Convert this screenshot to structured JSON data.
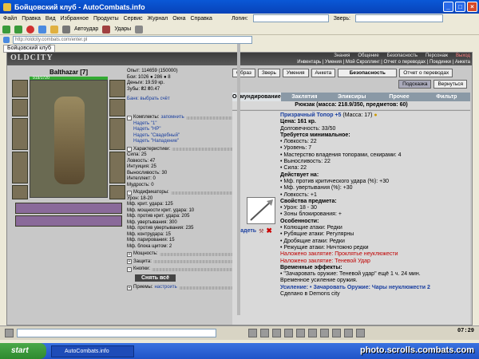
{
  "window": {
    "title": "Бойцовский клуб - AutoCombats.info"
  },
  "menu": [
    "Файл",
    "Правка",
    "Вид",
    "Избранное",
    "Продукты",
    "Сервис",
    "Журнал",
    "Окна",
    "Справка"
  ],
  "toolbar": {
    "login_label": "Логин:",
    "beast_label": "Зверь:",
    "autohit": "Автоудар",
    "hits": "Удары"
  },
  "address": {
    "url": "http://oldcity.combats.com/enter.pl"
  },
  "tabs": [
    "Бойцовский клуб"
  ],
  "site": {
    "logo": "OLDCITY",
    "topnav": [
      "Знания",
      "Общение",
      "Безопасность",
      "Персонаж",
      "Выход"
    ],
    "subnav": "Инвентарь | Умения | Мой Скроллинг | Отчет о переводах | Поединки | Анкета"
  },
  "char": {
    "name": "Balthazar [7]",
    "hp": "919/1720"
  },
  "stats1": [
    "Опыт: 114659 (150000)",
    "Бои: 1026 ● 286 ● 8",
    "Деньги: 19.59 кр.",
    "Зубы: ₴2 ₴0.47",
    "",
    "Банк: выбрать счёт"
  ],
  "sets": {
    "header": "Комплекты:",
    "save": "запомнить",
    "items": [
      "Надеть \"1\"",
      "Надеть \"HP\"",
      "Надеть \"Свадебный\"",
      "Надеть \"Нападение\""
    ]
  },
  "charstats": {
    "header": "Характеристики:",
    "rows": [
      "Сила: 25",
      "Ловкость: 47",
      "Интуиция: 25",
      "Выносливость: 30",
      "Интеллект: 0",
      "Мудрость: 0"
    ]
  },
  "mods": {
    "header": "Модификаторы:",
    "rows": [
      "Урон: 18-20",
      "Мф. крит. удара: 125",
      "Мф. мощности крит. удара: 10",
      "Мф. против крит. удара: 205",
      "Мф. увертывания: 300",
      "Мф. против увертывания: 235",
      "Мф. контрудара: 15",
      "Мф. парирования: 15",
      "Мф. блока щитом: 2"
    ]
  },
  "sections": [
    "Мощность:",
    "Защита:",
    "Кнопки:",
    "Приемы:"
  ],
  "undress": "Снять всё",
  "priemy_link": "настроить",
  "right": {
    "buttons": [
      "Образ",
      "Зверь",
      "Умения",
      "Анкета",
      "Безопасность",
      "Отчет о переводах"
    ],
    "hint": "Подсказка",
    "back": "Вернуться"
  },
  "inv_tabs": [
    "Обмундирование",
    "Заклятия",
    "Эликсиры",
    "Прочее",
    "Фильтр"
  ],
  "backpack": "Рюкзак (масса: 218.9/350, предметов: 60)",
  "item": {
    "name": "Призрачный Топор +5",
    "mass": "(Масса: 17)",
    "put_on": "надеть",
    "lines": [
      {
        "t": "Цена: 161 кр.",
        "c": "hdr"
      },
      {
        "t": "Долговечность: 33/50",
        "c": ""
      },
      {
        "t": "Требуется минимальное:",
        "c": "hdr"
      },
      {
        "t": "• Ловкость: 22",
        "c": ""
      },
      {
        "t": "• Уровень: 7",
        "c": ""
      },
      {
        "t": "• Мастерство владения топорами, секирами: 4",
        "c": ""
      },
      {
        "t": "• Выносливость: 22",
        "c": ""
      },
      {
        "t": "• Сила: 22",
        "c": ""
      },
      {
        "t": "Действует на:",
        "c": "hdr"
      },
      {
        "t": "• Мф. против критического удара (%): +30",
        "c": ""
      },
      {
        "t": "• Мф. увертывания (%): +30",
        "c": ""
      },
      {
        "t": "• Ловкость: +1",
        "c": ""
      },
      {
        "t": "Свойства предмета:",
        "c": "hdr"
      },
      {
        "t": "• Урон: 18 - 30",
        "c": ""
      },
      {
        "t": "• Зоны блокирования: +",
        "c": ""
      },
      {
        "t": "Особенности:",
        "c": "hdr"
      },
      {
        "t": "• Колющие атаки: Редки",
        "c": ""
      },
      {
        "t": "• Рубящие атаки: Регулярны",
        "c": ""
      },
      {
        "t": "• Дробящие атаки: Редки",
        "c": ""
      },
      {
        "t": "• Режущие атаки: Ничтожно редки",
        "c": ""
      },
      {
        "t": "Наложено заклятие: Проклятье неуклюжести",
        "c": "red"
      },
      {
        "t": "Наложено заклятие: Теневой Удар",
        "c": "red"
      },
      {
        "t": "Временные эффекты:",
        "c": "hdr"
      },
      {
        "t": "• \"Зачаровать оружие: Теневой удар\" ещё 1 ч. 24 мин.",
        "c": ""
      },
      {
        "t": "Временное усиление оружия.",
        "c": ""
      },
      {
        "t": "Усиление: • Зачаровать Оружие: Чары неуклюжести 2",
        "c": "blu"
      },
      {
        "t": "Сделано в Demons city",
        "c": ""
      }
    ]
  },
  "clock": "07:29",
  "taskbar": {
    "start": "start",
    "item": "AutoCombats.info",
    "watermark": "photo.scrolls.combats.com"
  }
}
